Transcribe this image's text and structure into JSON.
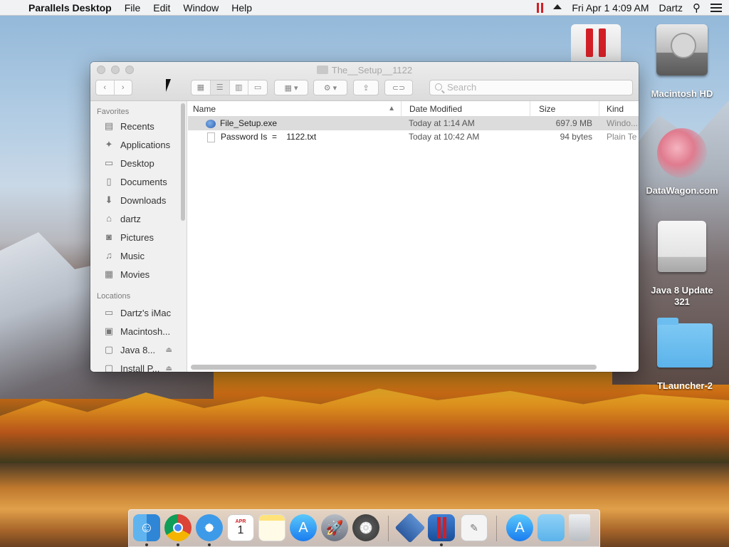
{
  "menubar": {
    "app_name": "Parallels Desktop",
    "menus": [
      "File",
      "Edit",
      "Window",
      "Help"
    ],
    "clock": "Fri Apr 1  4:09 AM",
    "user": "Dartz"
  },
  "desktop_icons": [
    {
      "label": "Macintosh HD"
    },
    {
      "label": "DataWagon.com"
    },
    {
      "label": "Java 8 Update 321"
    },
    {
      "label": "TLauncher-2"
    }
  ],
  "window": {
    "title": "The__Setup__1122",
    "search_placeholder": "Search",
    "sidebar": {
      "favorites_header": "Favorites",
      "favorites": [
        {
          "label": "Recents",
          "icon": "recents-icon"
        },
        {
          "label": "Applications",
          "icon": "applications-icon"
        },
        {
          "label": "Desktop",
          "icon": "desktop-icon"
        },
        {
          "label": "Documents",
          "icon": "documents-icon"
        },
        {
          "label": "Downloads",
          "icon": "downloads-icon"
        },
        {
          "label": "dartz",
          "icon": "home-icon"
        },
        {
          "label": "Pictures",
          "icon": "pictures-icon"
        },
        {
          "label": "Music",
          "icon": "music-icon"
        },
        {
          "label": "Movies",
          "icon": "movies-icon"
        }
      ],
      "locations_header": "Locations",
      "locations": [
        {
          "label": "Dartz's iMac",
          "icon": "imac-icon"
        },
        {
          "label": "Macintosh...",
          "icon": "disk-icon"
        },
        {
          "label": "Java 8...",
          "icon": "disk-icon"
        },
        {
          "label": "Install P...",
          "icon": "disk-icon"
        }
      ]
    },
    "columns": [
      "Name",
      "Date Modified",
      "Size",
      "Kind"
    ],
    "files": [
      {
        "name": "File_Setup.exe",
        "date": "Today at 1:14 AM",
        "size": "697.9 MB",
        "kind": "Windo...",
        "selected": true,
        "icon": "exe-icon"
      },
      {
        "name": "Password Is  =    1122.txt",
        "date": "Today at 10:42 AM",
        "size": "94 bytes",
        "kind": "Plain Te",
        "selected": false,
        "icon": "text-file-icon"
      }
    ]
  },
  "dock": {
    "apps": [
      "finder",
      "chrome",
      "safari",
      "calendar",
      "notes",
      "app-store",
      "launchpad",
      "system-preferences",
      "virtualbox",
      "parallels",
      "textedit",
      "app-store-2",
      "folder",
      "trash"
    ],
    "calendar_month": "APR",
    "calendar_day": "1"
  },
  "colors": {
    "parallels_red": "#d21f26",
    "folder_blue": "#5bb3ea",
    "selection_gray": "#dcdcdc"
  }
}
